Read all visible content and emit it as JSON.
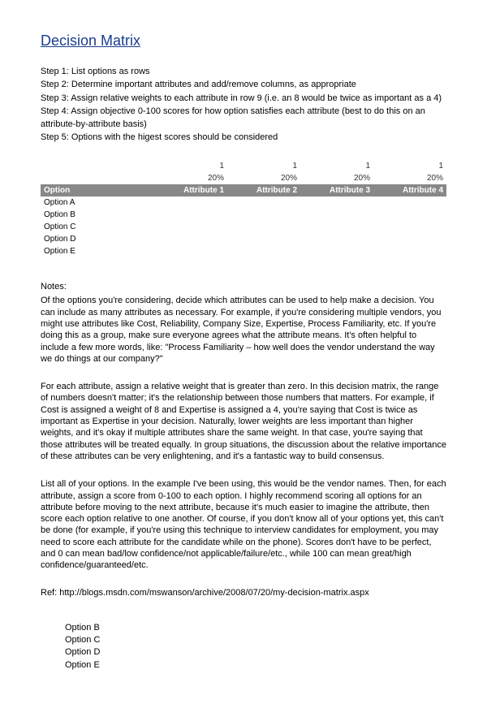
{
  "title": "Decision Matrix",
  "steps": [
    "Step 1: List options as rows",
    "Step 2: Determine important attributes and add/remove columns, as appropriate",
    "Step 3: Assign relative weights to each attribute in row 9 (i.e. an 8 would be twice as important as a 4)",
    "Step 4: Assign objective 0-100 scores for how option satisfies each attribute (best to do this on an attribute-by-attribute basis)",
    "Step 5: Options with the higest scores should be considered"
  ],
  "matrix": {
    "weights": [
      "1",
      "1",
      "1",
      "1"
    ],
    "percents": [
      "20%",
      "20%",
      "20%",
      "20%"
    ],
    "header": {
      "option": "Option",
      "attrs": [
        "Attribute 1",
        "Attribute 2",
        "Attribute 3",
        "Attribute 4"
      ]
    },
    "options": [
      "Option A",
      "Option B",
      "Option C",
      "Option D",
      "Option E"
    ]
  },
  "notes_heading": "Notes:",
  "para1": "Of the options you're considering, decide which attributes can be used to help make a decision. You can include as many attributes as necessary. For example, if you're considering multiple vendors, you might use attributes like Cost, Reliability, Company Size, Expertise, Process Familiarity, etc. If you're doing this as a group, make sure everyone agrees what the attribute means. It's often helpful to include a few more words, like: \"Process Familiarity – how well does the vendor understand the way we do things at our company?\"",
  "para2": "For each attribute, assign a relative weight that is greater than zero. In this decision matrix, the range of numbers doesn't matter; it's the relationship between those numbers that matters. For example, if Cost is assigned a weight of 8 and Expertise is assigned a 4, you're saying that Cost is twice as important as Expertise in your decision. Naturally, lower weights are less important than higher weights, and it's okay if multiple attributes share the same weight. In that case, you're saying that those attributes will be treated equally. In group situations, the discussion about the relative importance of these attributes can be very enlightening, and it's a fantastic way to build consensus.",
  "para3": "List all of your options. In the example I've been using, this would be the vendor names. Then, for each attribute, assign a score from 0-100 to each option. I highly recommend scoring all options for an attribute before moving to the next attribute, because it's much easier to imagine the attribute, then score each option relative to one another. Of course, if you don't know all of your options yet, this can't be done (for example, if you're using this technique to interview candidates for employment, you may need to score each attribute for the candidate while on the phone). Scores don't have to be perfect, and 0 can mean bad/low confidence/not applicable/failure/etc., while 100 can mean great/high confidence/guaranteed/etc.",
  "ref": "Ref: http://blogs.msdn.com/mswanson/archive/2008/07/20/my-decision-matrix.aspx",
  "bottom_options": [
    "Option B",
    "Option C",
    "Option D",
    "Option E"
  ]
}
